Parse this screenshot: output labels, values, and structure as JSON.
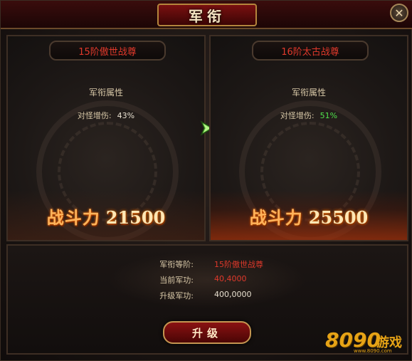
{
  "window": {
    "title": "军衔",
    "close_symbol": "✕"
  },
  "current": {
    "rank": "15阶傲世战尊",
    "attr_title": "军衔属性",
    "attr_label": "对怪增伤:",
    "attr_value": "43%",
    "power_label": "战斗力",
    "power_value": "21500"
  },
  "next": {
    "rank": "16阶太古战尊",
    "attr_title": "军衔属性",
    "attr_label": "对怪增伤:",
    "attr_value": "51%",
    "power_label": "战斗力",
    "power_value": "25500"
  },
  "info": {
    "rank_label": "军衔等阶:",
    "rank_value": "15阶傲世战尊",
    "merit_label": "当前军功:",
    "merit_value": "40,4000",
    "req_label": "升级军功:",
    "req_value": "400,0000"
  },
  "upgrade_label": "升级",
  "watermark": {
    "num": "8090",
    "text": "游戏",
    "url": "www.8090.com"
  },
  "colors": {
    "accent_red": "#e0392b",
    "green": "#4fe04b",
    "gold": "#c49550"
  },
  "icons": {
    "arrow": "right-arrow-icon",
    "close": "close-icon"
  }
}
